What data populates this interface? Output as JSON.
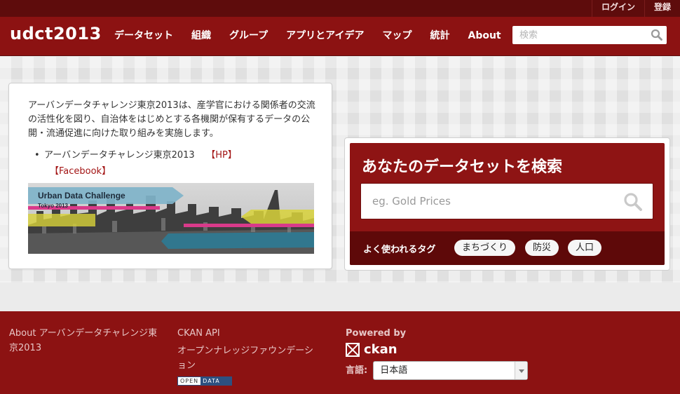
{
  "account": {
    "login": "ログイン",
    "register": "登録"
  },
  "header": {
    "brand": "udct2013",
    "nav": [
      "データセット",
      "組織",
      "グループ",
      "アプリとアイデア",
      "マップ",
      "統計",
      "About"
    ],
    "search_placeholder": "検索"
  },
  "intro": {
    "text": "アーバンデータチャレンジ東京2013は、産学官における関係者の交流の活性化を図り、自治体をはじめとする各機関が保有するデータの公開・流通促進に向けた取り組みを実施します。",
    "item_label": "アーバンデータチャレンジ東京2013",
    "hp_link": "【HP】",
    "facebook_link": "【Facebook】",
    "banner_title": "Urban Data Challenge",
    "banner_subtitle": "Tokyo 2013"
  },
  "search": {
    "title": "あなたのデータセットを検索",
    "placeholder": "eg. Gold Prices",
    "tags_label": "よく使われるタグ",
    "tags": [
      "まちづくり",
      "防災",
      "人口"
    ]
  },
  "footer": {
    "about": "About アーバンデータチャレンジ東京2013",
    "ckan_api": "CKAN API",
    "okf": "オープンナレッジファウンデーション",
    "open_data_badge": [
      "OPEN",
      "DATA"
    ],
    "powered_by": "Powered by",
    "ckan": "ckan",
    "language_label": "言語:",
    "language_value": "日本語"
  },
  "colors": {
    "brand_red": "#8c1212",
    "dark_red": "#5e0c0c",
    "link_red": "#a31515"
  }
}
